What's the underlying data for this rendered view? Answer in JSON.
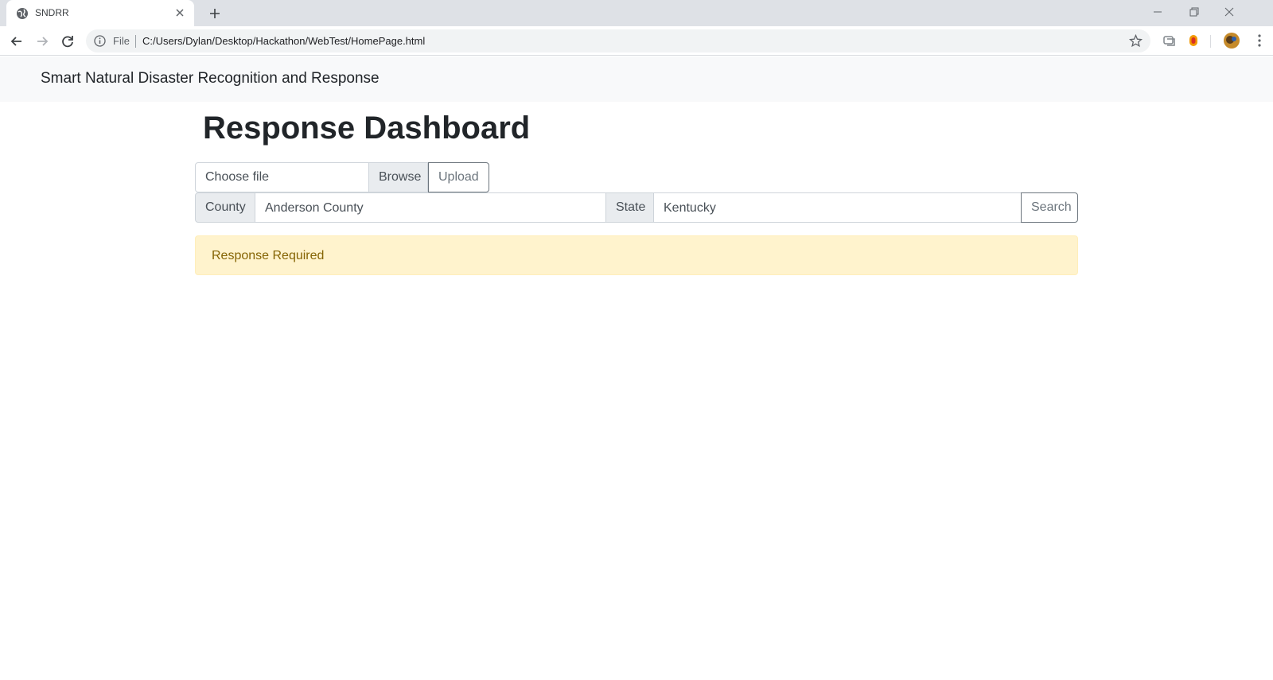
{
  "browser": {
    "tab_title": "SNDRR",
    "scheme_label": "File",
    "url": "C:/Users/Dylan/Desktop/Hackathon/WebTest/HomePage.html"
  },
  "navbar": {
    "brand": "Smart Natural Disaster Recognition and Response"
  },
  "main": {
    "title": "Response Dashboard",
    "upload": {
      "file_placeholder": "Choose file",
      "browse_label": "Browse",
      "upload_label": "Upload"
    },
    "search": {
      "county_label": "County",
      "county_value": "Anderson County",
      "state_label": "State",
      "state_value": "Kentucky",
      "search_label": "Search"
    },
    "alert": {
      "text": "Response Required",
      "color": "#856404",
      "background": "#fff3cd"
    }
  }
}
